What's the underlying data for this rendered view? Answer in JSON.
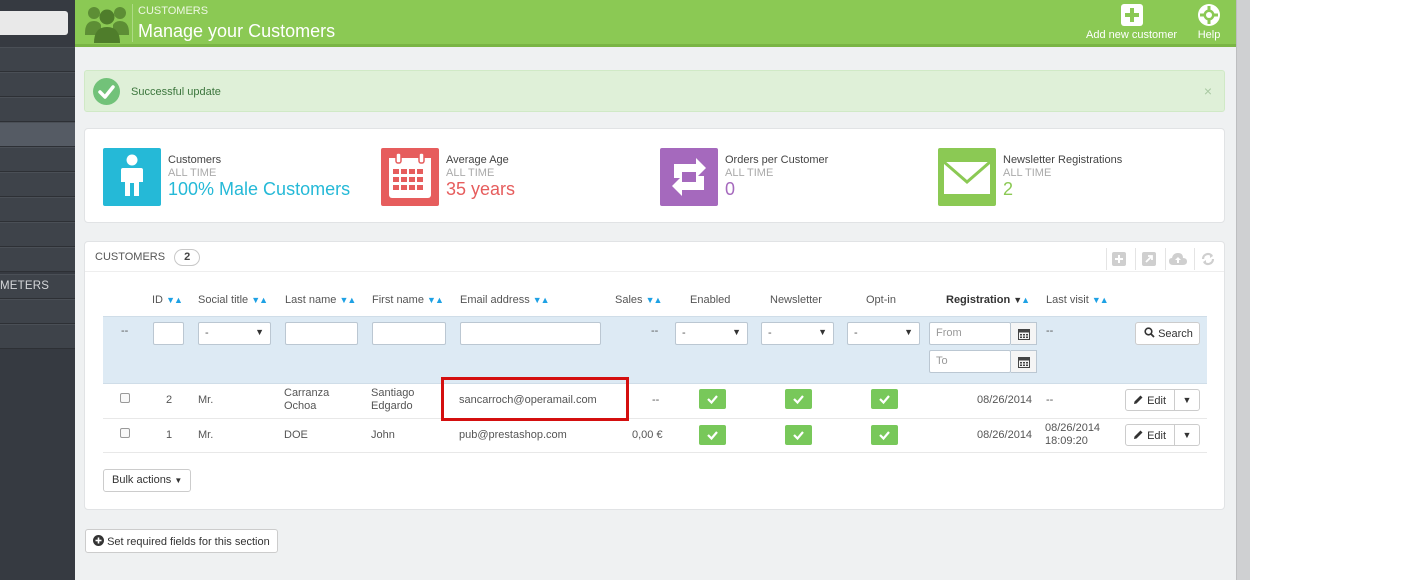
{
  "sidebar": {
    "search_placeholder": "",
    "items": [
      "",
      "",
      "",
      "",
      "",
      "",
      "",
      "",
      "METERS",
      "",
      ""
    ]
  },
  "header": {
    "breadcrumb": "CUSTOMERS",
    "title": "Manage your Customers",
    "add_label": "Add new customer",
    "help_label": "Help",
    "accent_color": "#8bc954"
  },
  "alert": {
    "message": "Successful update",
    "close": "×"
  },
  "kpis": [
    {
      "label": "Customers",
      "period": "ALL TIME",
      "value": "100% Male Customers",
      "color": "#25b9d7",
      "icon": "male-user-icon"
    },
    {
      "label": "Average Age",
      "period": "ALL TIME",
      "value": "35 years",
      "color": "#e65d5d",
      "icon": "calendar-icon"
    },
    {
      "label": "Orders per Customer",
      "period": "ALL TIME",
      "value": "0",
      "color": "#a569bd",
      "icon": "retweet-icon"
    },
    {
      "label": "Newsletter Registrations",
      "period": "ALL TIME",
      "value": "2",
      "color": "#8bc954",
      "icon": "envelope-icon"
    }
  ],
  "panel": {
    "title": "CUSTOMERS",
    "count": "2"
  },
  "columns": {
    "id": "ID",
    "social_title": "Social title",
    "last_name": "Last name",
    "first_name": "First name",
    "email": "Email address",
    "sales": "Sales",
    "enabled": "Enabled",
    "newsletter": "Newsletter",
    "optin": "Opt-in",
    "registration": "Registration",
    "last_visit": "Last visit"
  },
  "filters": {
    "dash": "--",
    "select_default": "-",
    "from_placeholder": "From",
    "to_placeholder": "To",
    "search_label": "Search"
  },
  "rows": [
    {
      "id": "2",
      "social_title": "Mr.",
      "last_name_1": "Carranza",
      "last_name_2": "Ochoa",
      "first_name_1": "Santiago",
      "first_name_2": "Edgardo",
      "email": "sancarroch@operamail.com",
      "sales": "--",
      "registration": "08/26/2014",
      "last_visit_1": "--",
      "last_visit_2": "",
      "edit": "Edit"
    },
    {
      "id": "1",
      "social_title": "Mr.",
      "last_name_1": "DOE",
      "last_name_2": "",
      "first_name_1": "John",
      "first_name_2": "",
      "email": "pub@prestashop.com",
      "sales": "0,00 €",
      "registration": "08/26/2014",
      "last_visit_1": "08/26/2014",
      "last_visit_2": "18:09:20",
      "edit": "Edit"
    }
  ],
  "bulk_label": "Bulk actions",
  "required_fields_label": "Set required fields for this section"
}
